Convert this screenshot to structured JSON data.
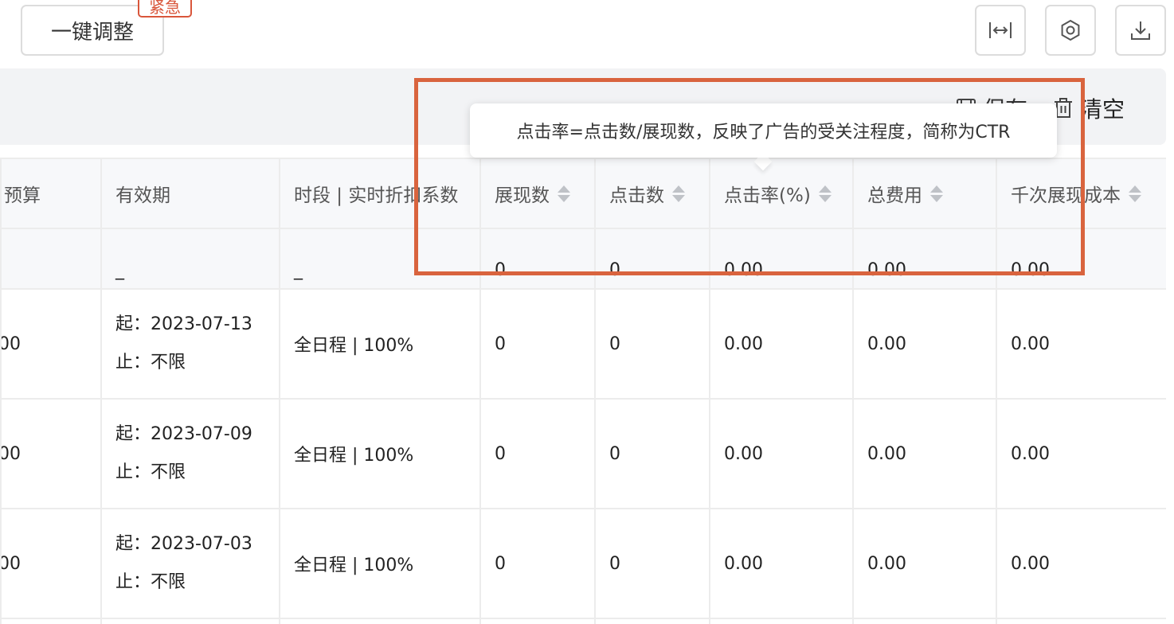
{
  "toolbar": {
    "adjust_label": "一键调整",
    "urgent_badge": "紧急",
    "icons": [
      "fit-width-icon",
      "settings-icon",
      "download-icon"
    ]
  },
  "filter_bar": {
    "save_label": "保存",
    "clear_label": "清空"
  },
  "tooltip": {
    "text": "点击率=点击数/展现数，反映了广告的受关注程度，简称为CTR"
  },
  "table": {
    "headers": {
      "budget": "日预算",
      "validity": "有效期",
      "period": "时段 | 实时折扣系数",
      "impressions": "展现数",
      "clicks": "点击数",
      "ctr": "点击率(%)",
      "cost": "总费用",
      "cpm": "千次展现成本"
    },
    "total": {
      "budget": "",
      "validity": "_",
      "period": "_",
      "impressions": "0",
      "clicks": "0",
      "ctr": "0.00",
      "cost": "0.00",
      "cpm": "0.00"
    },
    "rows": [
      {
        "budget": "00",
        "start": "起：2023-07-13",
        "end": "止：不限",
        "period": "全日程 | 100%",
        "impressions": "0",
        "clicks": "0",
        "ctr": "0.00",
        "cost": "0.00",
        "cpm": "0.00"
      },
      {
        "budget": "00",
        "start": "起：2023-07-09",
        "end": "止：不限",
        "period": "全日程 | 100%",
        "impressions": "0",
        "clicks": "0",
        "ctr": "0.00",
        "cost": "0.00",
        "cpm": "0.00"
      },
      {
        "budget": "00",
        "start": "起：2023-07-03",
        "end": "止：不限",
        "period": "全日程 | 100%",
        "impressions": "0",
        "clicks": "0",
        "ctr": "0.00",
        "cost": "0.00",
        "cpm": "0.00"
      }
    ]
  },
  "colors": {
    "accent_red": "#d9563b",
    "highlight_border": "#d9643e",
    "header_bg": "#f7f8fa",
    "filter_bg": "#f2f3f5"
  }
}
